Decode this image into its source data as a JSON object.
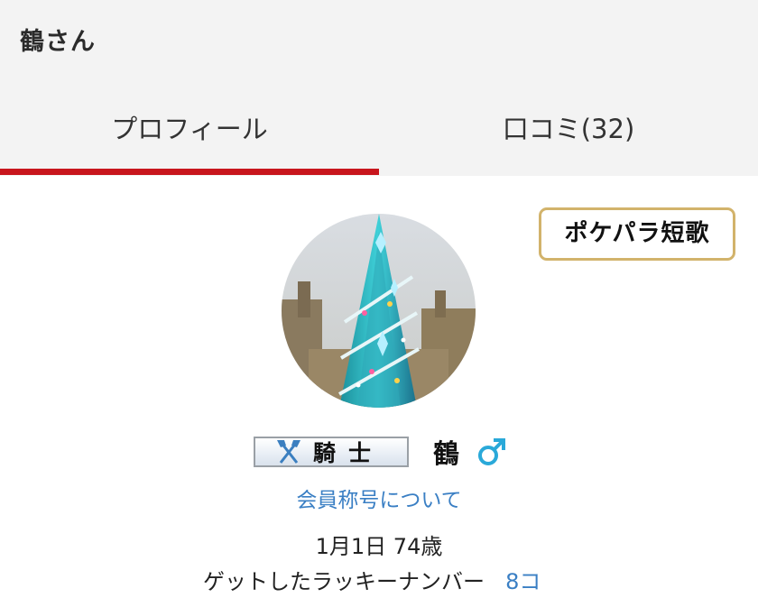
{
  "header": {
    "title": "鶴さん"
  },
  "tabs": [
    {
      "label": "プロフィール",
      "active": true
    },
    {
      "label": "口コミ(32)",
      "active": false
    }
  ],
  "tanka_button": {
    "label": "ポケパラ短歌"
  },
  "profile": {
    "title_badge": "騎士",
    "title_badge_icon": "crossed-axes-icon",
    "name": "鶴",
    "gender_icon": "male-symbol-icon",
    "member_title_link": "会員称号について",
    "birthday": "1月1日 74歳",
    "lucky_label": "ゲットしたラッキーナンバー",
    "lucky_count": "8コ"
  },
  "colors": {
    "accent_red": "#c8161d",
    "link_blue": "#3a7fc4",
    "gold_border": "#d2b36b",
    "gender_cyan": "#2aa9d9"
  }
}
